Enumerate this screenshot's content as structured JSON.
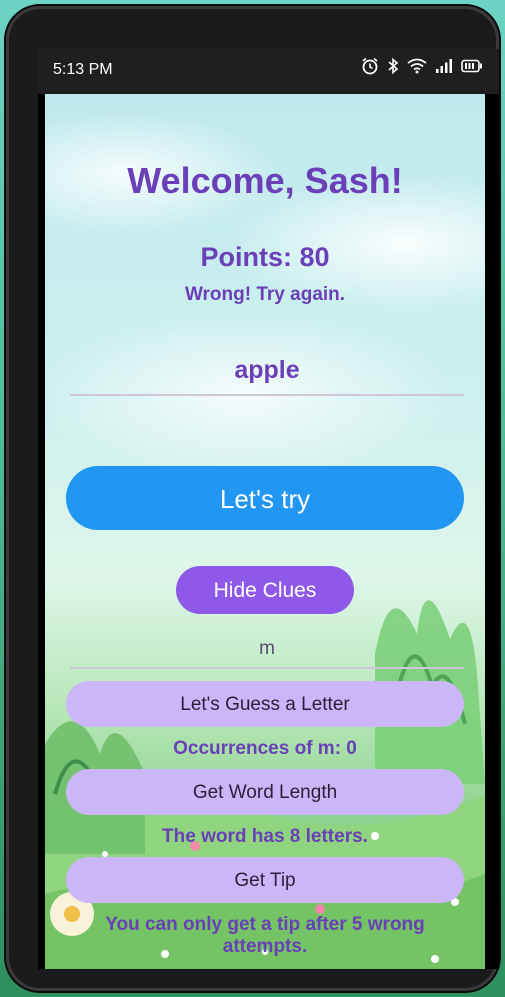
{
  "status_bar": {
    "time": "5:13 PM",
    "icons": [
      "alarm-icon",
      "bluetooth-icon",
      "wifi-icon",
      "signal-icon",
      "battery-icon"
    ]
  },
  "app": {
    "welcome": "Welcome, Sash!",
    "points": "Points: 80",
    "feedback": "Wrong! Try again.",
    "guess_input_value": "apple",
    "try_button": "Let's try",
    "hide_clues_button": "Hide Clues",
    "letter_input_value": "m",
    "guess_letter_button": "Let's Guess a Letter",
    "occurrences_text": "Occurrences of m: 0",
    "word_length_button": "Get Word Length",
    "word_length_text": "The word has 8 letters.",
    "tip_button": "Get Tip",
    "tip_text": "You can only get a tip after 5 wrong attempts."
  },
  "colors": {
    "accent_purple": "#6b3fb8",
    "primary_blue": "#2196f3",
    "hide_button": "#8e59e8",
    "lavender_button": "#cbb7f7"
  }
}
